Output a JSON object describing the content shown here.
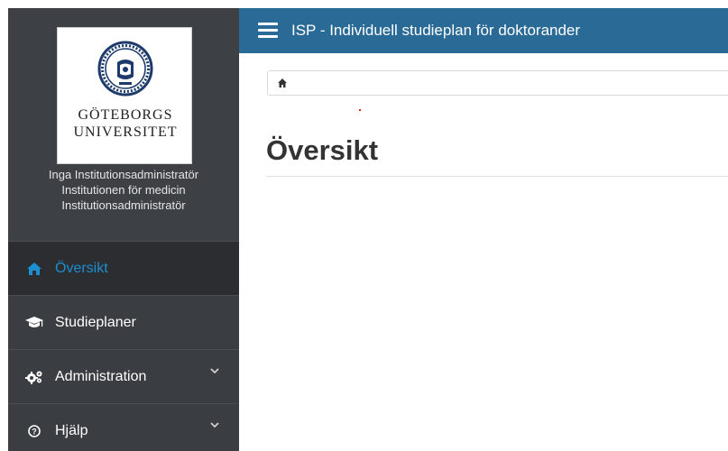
{
  "app": {
    "title": "ISP - Individuell studieplan för doktorander",
    "header_color": "#2a6a96"
  },
  "sidebar": {
    "logo": {
      "line1": "GÖTEBORGS",
      "line2": "UNIVERSITET"
    },
    "user": {
      "name": "Inga Institutionsadministratör",
      "department": "Institutionen för medicin",
      "role": "Institutionsadministratör"
    },
    "items": [
      {
        "label": "Översikt",
        "icon": "home-icon",
        "active": true
      },
      {
        "label": "Studieplaner",
        "icon": "graduation-cap-icon",
        "active": false
      },
      {
        "label": "Administration",
        "icon": "cogs-icon",
        "active": false,
        "expandable": true
      },
      {
        "label": "Hjälp",
        "icon": "help-icon",
        "active": false,
        "expandable": true
      }
    ],
    "active_color": "#1c8fcf"
  },
  "breadcrumb": {
    "home_icon": "home-icon"
  },
  "main": {
    "page_title": "Översikt"
  }
}
